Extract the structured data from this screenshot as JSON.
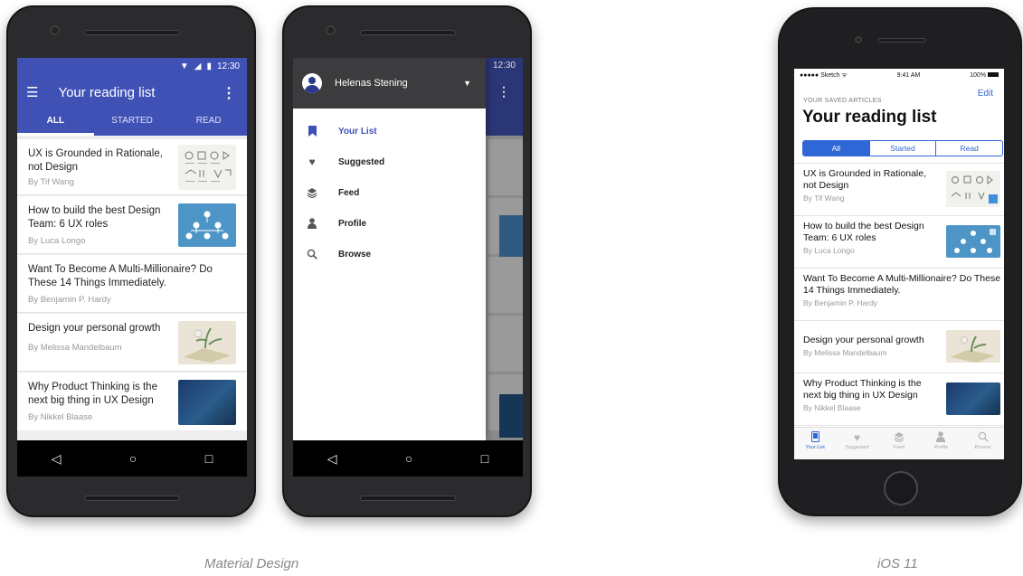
{
  "android1": {
    "status_time": "12:30",
    "status_icons": [
      "wifi-icon",
      "signal-icon",
      "battery-icon"
    ],
    "title": "Your reading list",
    "tabs": [
      "ALL",
      "STARTED",
      "READ"
    ],
    "articles": [
      {
        "title": "UX is Grounded in Rationale, not Design",
        "author": "By Tif Wang",
        "thumb": "sketch"
      },
      {
        "title": "How to build the best Design Team: 6 UX roles",
        "author": "By Luca Longo",
        "thumb": "team"
      },
      {
        "title": "Want To Become A Multi-Millionaire? Do These 14 Things Immediately.",
        "author": "By Benjamin P. Hardy",
        "thumb": ""
      },
      {
        "title": "Design your personal growth",
        "author": "By Melissa Mandelbaum",
        "thumb": "plant"
      },
      {
        "title": "Why Product Thinking is the next big thing in UX Design",
        "author": "By Nikkel Blaase",
        "thumb": "dark"
      }
    ],
    "nav": [
      "◁",
      "○",
      "□"
    ]
  },
  "android2": {
    "status_time": "12:30",
    "user": "Helenas Stening",
    "drawer_items": [
      {
        "label": "Your List",
        "icon": "bookmark-icon",
        "selected": true
      },
      {
        "label": "Suggested",
        "icon": "heart-icon",
        "selected": false
      },
      {
        "label": "Feed",
        "icon": "layers-icon",
        "selected": false
      },
      {
        "label": "Profile",
        "icon": "person-icon",
        "selected": false
      },
      {
        "label": "Browse",
        "icon": "search-icon",
        "selected": false
      }
    ],
    "nav": [
      "◁",
      "○",
      "□"
    ]
  },
  "ios": {
    "carrier": "●●●●● Sketch ᯤ",
    "time": "9:41 AM",
    "battery": "100%",
    "subtitle": "YOUR SAVED ARTICLES",
    "edit": "Edit",
    "title": "Your reading list",
    "segments": [
      "All",
      "Started",
      "Read"
    ],
    "articles": [
      {
        "title": "UX is Grounded in Rationale, not Design",
        "author": "By Tif Wang"
      },
      {
        "title": "How to build the best Design Team: 6 UX roles",
        "author": "By Luca Longo"
      },
      {
        "title": "Want To Become A Multi-Millionaire? Do These 14 Things Immediately.",
        "author": "By Benjamin P. Hardy"
      },
      {
        "title": "Design your personal growth",
        "author": "By Melissa Mandelbaum"
      },
      {
        "title": "Why Product Thinking is the next big thing in UX Design",
        "author": "By Nikkel Blaase"
      }
    ],
    "tabbar": [
      {
        "label": "Your List",
        "icon": "bookmark-icon"
      },
      {
        "label": "Suggested",
        "icon": "heart-icon"
      },
      {
        "label": "Feed",
        "icon": "layers-icon"
      },
      {
        "label": "Profile",
        "icon": "person-icon"
      },
      {
        "label": "Browse",
        "icon": "search-icon"
      }
    ]
  },
  "captions": {
    "material": "Material Design",
    "ios": "iOS 11"
  },
  "colors": {
    "material_primary": "#3f51b5",
    "ios_tint": "#2f67d6",
    "drawer_header": "#3c3c3e"
  }
}
